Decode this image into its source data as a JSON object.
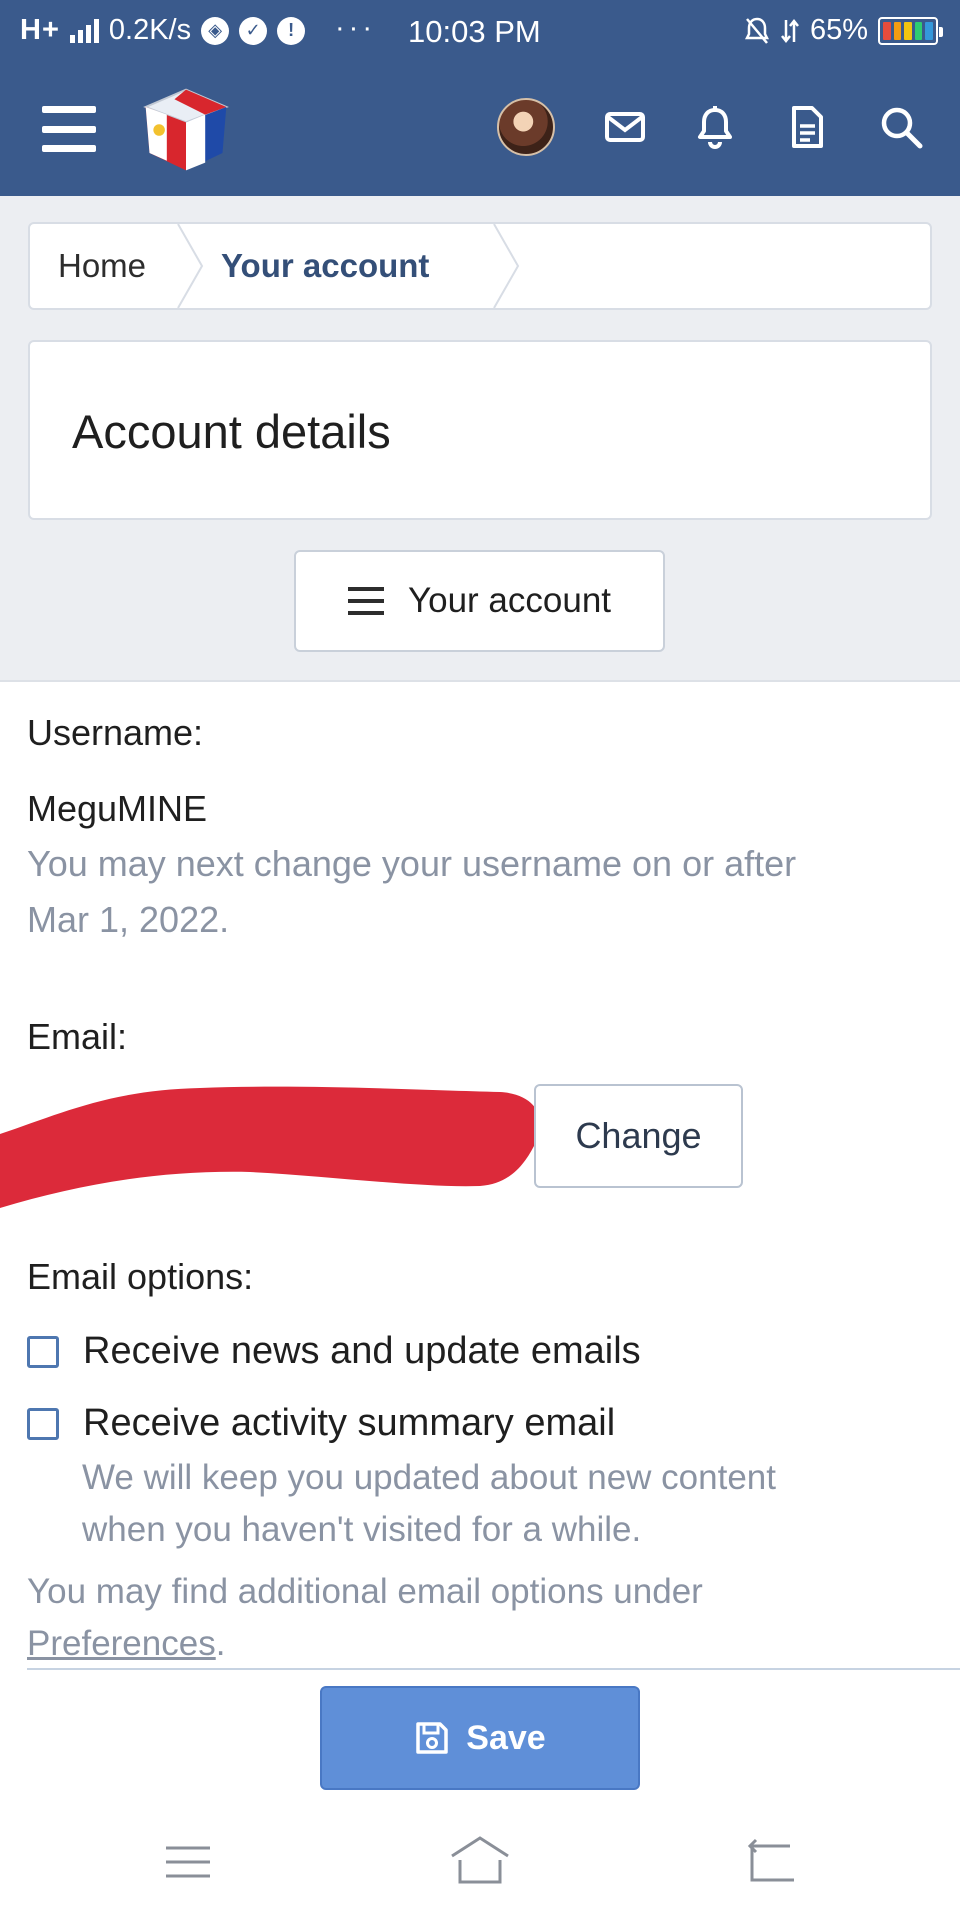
{
  "status_bar": {
    "network": "H+",
    "speed": "0.2K/s",
    "dots": "···",
    "time": "10:03 PM",
    "battery": "65%",
    "signal_icon": "signal-bars-icon",
    "notification_icons": [
      "vpn-icon",
      "check-icon",
      "alert-icon"
    ],
    "right_icons": [
      "silent-icon",
      "data-arrows-icon"
    ],
    "battery_colors": [
      "#e74c3c",
      "#f39c12",
      "#f1c40f",
      "#2ecc71",
      "#3498db"
    ]
  },
  "header": {
    "menu_icon": "hamburger-menu-icon",
    "logo": "site-logo",
    "icons": [
      "avatar",
      "inbox-icon",
      "bell-icon",
      "document-icon",
      "search-icon"
    ],
    "background": "#3a5a8c"
  },
  "breadcrumb": {
    "home": "Home",
    "current": "Your account"
  },
  "page": {
    "title": "Account details",
    "account_menu_label": "Your account"
  },
  "form": {
    "username_label": "Username:",
    "username_value": "MeguMINE",
    "username_hint_line1": "You may next change your username on or after",
    "username_hint_line2": "Mar 1, 2022.",
    "email_label": "Email:",
    "change_button": "Change",
    "email_options_label": "Email options:",
    "option_news": "Receive news and update emails",
    "option_news_checked": false,
    "option_activity": "Receive activity summary email",
    "option_activity_checked": false,
    "activity_hint_line1": "We will keep you updated about new content",
    "activity_hint_line2": "when you haven't visited for a while.",
    "prefs_text": "You may find additional email options under",
    "prefs_link": "Preferences",
    "prefs_end": ".",
    "save_button": "Save",
    "redaction_color": "#dc2a3a"
  },
  "navbar": {
    "icons": [
      "recent-apps-icon",
      "home-icon",
      "back-icon"
    ]
  }
}
